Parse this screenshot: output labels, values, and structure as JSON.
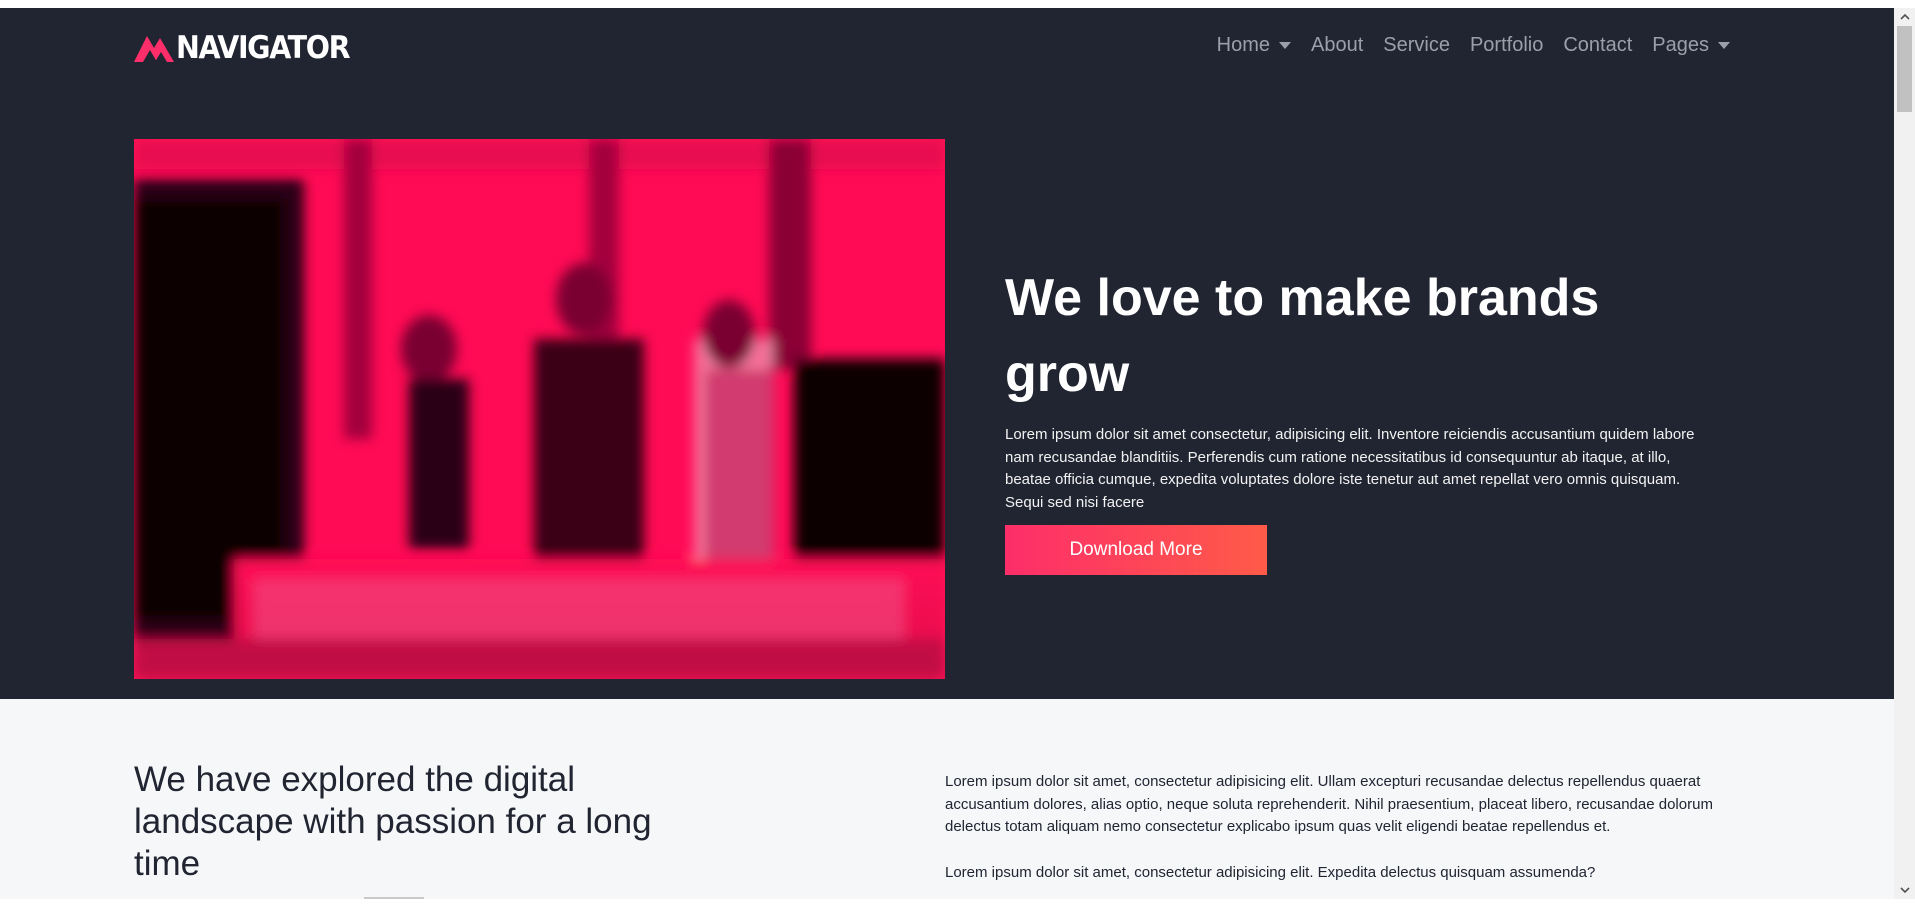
{
  "brand": {
    "name": "NAVIGATOR",
    "logo_icon": "mountain-logo-icon",
    "accent_color": "#fd2e69"
  },
  "nav": {
    "items": [
      {
        "label": "Home",
        "dropdown": true
      },
      {
        "label": "About",
        "dropdown": false
      },
      {
        "label": "Service",
        "dropdown": false
      },
      {
        "label": "Portfolio",
        "dropdown": false
      },
      {
        "label": "Contact",
        "dropdown": false
      },
      {
        "label": "Pages",
        "dropdown": true
      }
    ]
  },
  "hero": {
    "title": "We love to make brands grow",
    "text": "Lorem ipsum dolor sit amet consectetur, adipisicing elit. Inventore reiciendis accusantium quidem labore nam recusandae blanditiis. Perferendis cum ratione necessitatibus id consequuntur ab itaque, at illo, beatae officia cumque, expedita voluptates dolore iste tenetur aut amet repellat vero omnis quisquam. Sequi sed nisi facere",
    "button_label": "Download More",
    "background_color": "#212532",
    "button_gradient": [
      "#fd2e69",
      "#ff5b48"
    ]
  },
  "about": {
    "title": "We have explored the digital landscape with passion for a long time",
    "paragraphs": [
      "Lorem ipsum dolor sit amet, consectetur adipisicing elit. Ullam excepturi recusandae delectus repellendus quaerat accusantium dolores, alias optio, neque soluta reprehenderit. Nihil praesentium, placeat libero, recusandae dolorum delectus totam aliquam nemo consectetur explicabo ipsum quas velit eligendi beatae repellendus et.",
      "Lorem ipsum dolor sit amet, consectetur adipisicing elit. Expedita delectus quisquam assumenda?"
    ]
  },
  "scrollbar": {
    "up_icon": "chevron-up-icon",
    "down_icon": "chevron-down-icon"
  }
}
